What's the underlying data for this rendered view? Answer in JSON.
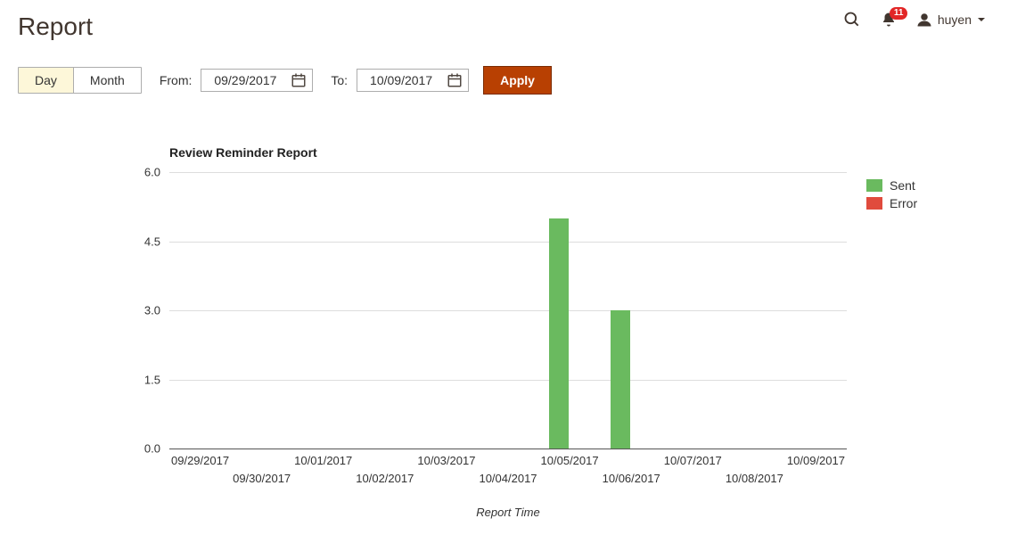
{
  "header": {
    "title": "Report",
    "notification_count": "11",
    "username": "huyen"
  },
  "controls": {
    "seg_day": "Day",
    "seg_month": "Month",
    "from_label": "From:",
    "to_label": "To:",
    "from_value": "09/29/2017",
    "to_value": "10/09/2017",
    "apply_label": "Apply"
  },
  "chart_data": {
    "type": "bar",
    "title": "Review Reminder Report",
    "xlabel": "Report Time",
    "ylabel": "",
    "ylim": [
      0,
      6.0
    ],
    "yticks": [
      0.0,
      1.5,
      3.0,
      4.5,
      6.0
    ],
    "categories": [
      "09/29/2017",
      "09/30/2017",
      "10/01/2017",
      "10/02/2017",
      "10/03/2017",
      "10/04/2017",
      "10/05/2017",
      "10/06/2017",
      "10/07/2017",
      "10/08/2017",
      "10/09/2017"
    ],
    "series": [
      {
        "name": "Sent",
        "color": "#6aba5f",
        "values": [
          0,
          0,
          0,
          0,
          0,
          0,
          5,
          3,
          0,
          0,
          0
        ]
      },
      {
        "name": "Error",
        "color": "#e04b3d",
        "values": [
          0,
          0,
          0,
          0,
          0,
          0,
          0,
          0,
          0,
          0,
          0
        ]
      }
    ],
    "legend_position": "right"
  }
}
